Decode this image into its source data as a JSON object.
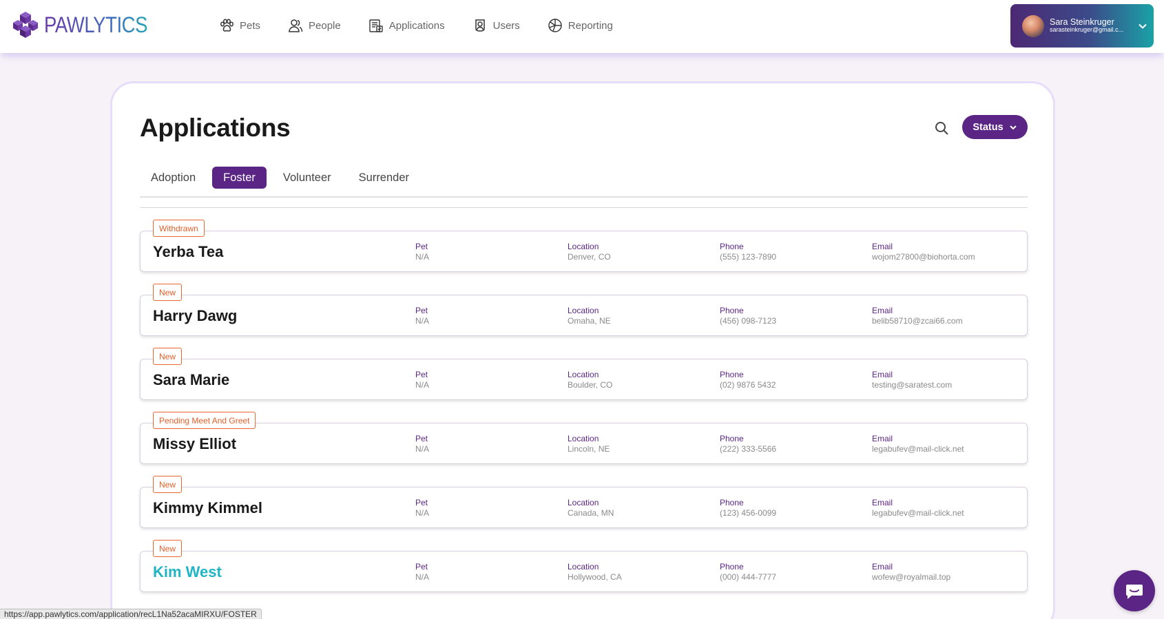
{
  "brand": {
    "name": "PAWLYTICS"
  },
  "nav": {
    "items": [
      {
        "label": "Pets",
        "icon": "paw-icon"
      },
      {
        "label": "People",
        "icon": "people-icon"
      },
      {
        "label": "Applications",
        "icon": "applications-icon"
      },
      {
        "label": "Users",
        "icon": "users-icon"
      },
      {
        "label": "Reporting",
        "icon": "reporting-icon"
      }
    ]
  },
  "user": {
    "name": "Sara Steinkruger",
    "email": "sarasteinkruger@gmail.c..."
  },
  "page": {
    "title": "Applications",
    "status_label": "Status"
  },
  "tabs": [
    {
      "label": "Adoption",
      "active": false
    },
    {
      "label": "Foster",
      "active": true
    },
    {
      "label": "Volunteer",
      "active": false
    },
    {
      "label": "Surrender",
      "active": false
    }
  ],
  "field_labels": {
    "pet": "Pet",
    "location": "Location",
    "phone": "Phone",
    "email": "Email"
  },
  "applications": [
    {
      "status": "Withdrawn",
      "name": "Yerba Tea",
      "pet": "N/A",
      "location": "Denver, CO",
      "phone": "(555) 123-7890",
      "email": "wojom27800@biohorta.com"
    },
    {
      "status": "New",
      "name": "Harry Dawg",
      "pet": "N/A",
      "location": "Omaha, NE",
      "phone": "(456) 098-7123",
      "email": "belib58710@zcai66.com"
    },
    {
      "status": "New",
      "name": "Sara Marie",
      "pet": "N/A",
      "location": "Boulder, CO",
      "phone": "(02) 9876 5432",
      "email": "testing@saratest.com"
    },
    {
      "status": "Pending Meet And Greet",
      "name": "Missy Elliot",
      "pet": "N/A",
      "location": "Lincoln, NE",
      "phone": "(222) 333-5566",
      "email": "legabufev@mail-click.net"
    },
    {
      "status": "New",
      "name": "Kimmy Kimmel",
      "pet": "N/A",
      "location": "Canada, MN",
      "phone": "(123) 456-0099",
      "email": "legabufev@mail-click.net"
    },
    {
      "status": "New",
      "name": "Kim West",
      "pet": "N/A",
      "location": "Hollywood, CA",
      "phone": "(000) 444-7777",
      "email": "wofew@royalmail.top"
    }
  ],
  "status_bar": {
    "url": "https://app.pawlytics.com/application/recL1Na52acaMIRXU/FOSTER"
  },
  "colors": {
    "primary": "#5b2585",
    "badge": "#e0602a",
    "link": "#1fb5c2",
    "background": "#f6f2f8"
  }
}
